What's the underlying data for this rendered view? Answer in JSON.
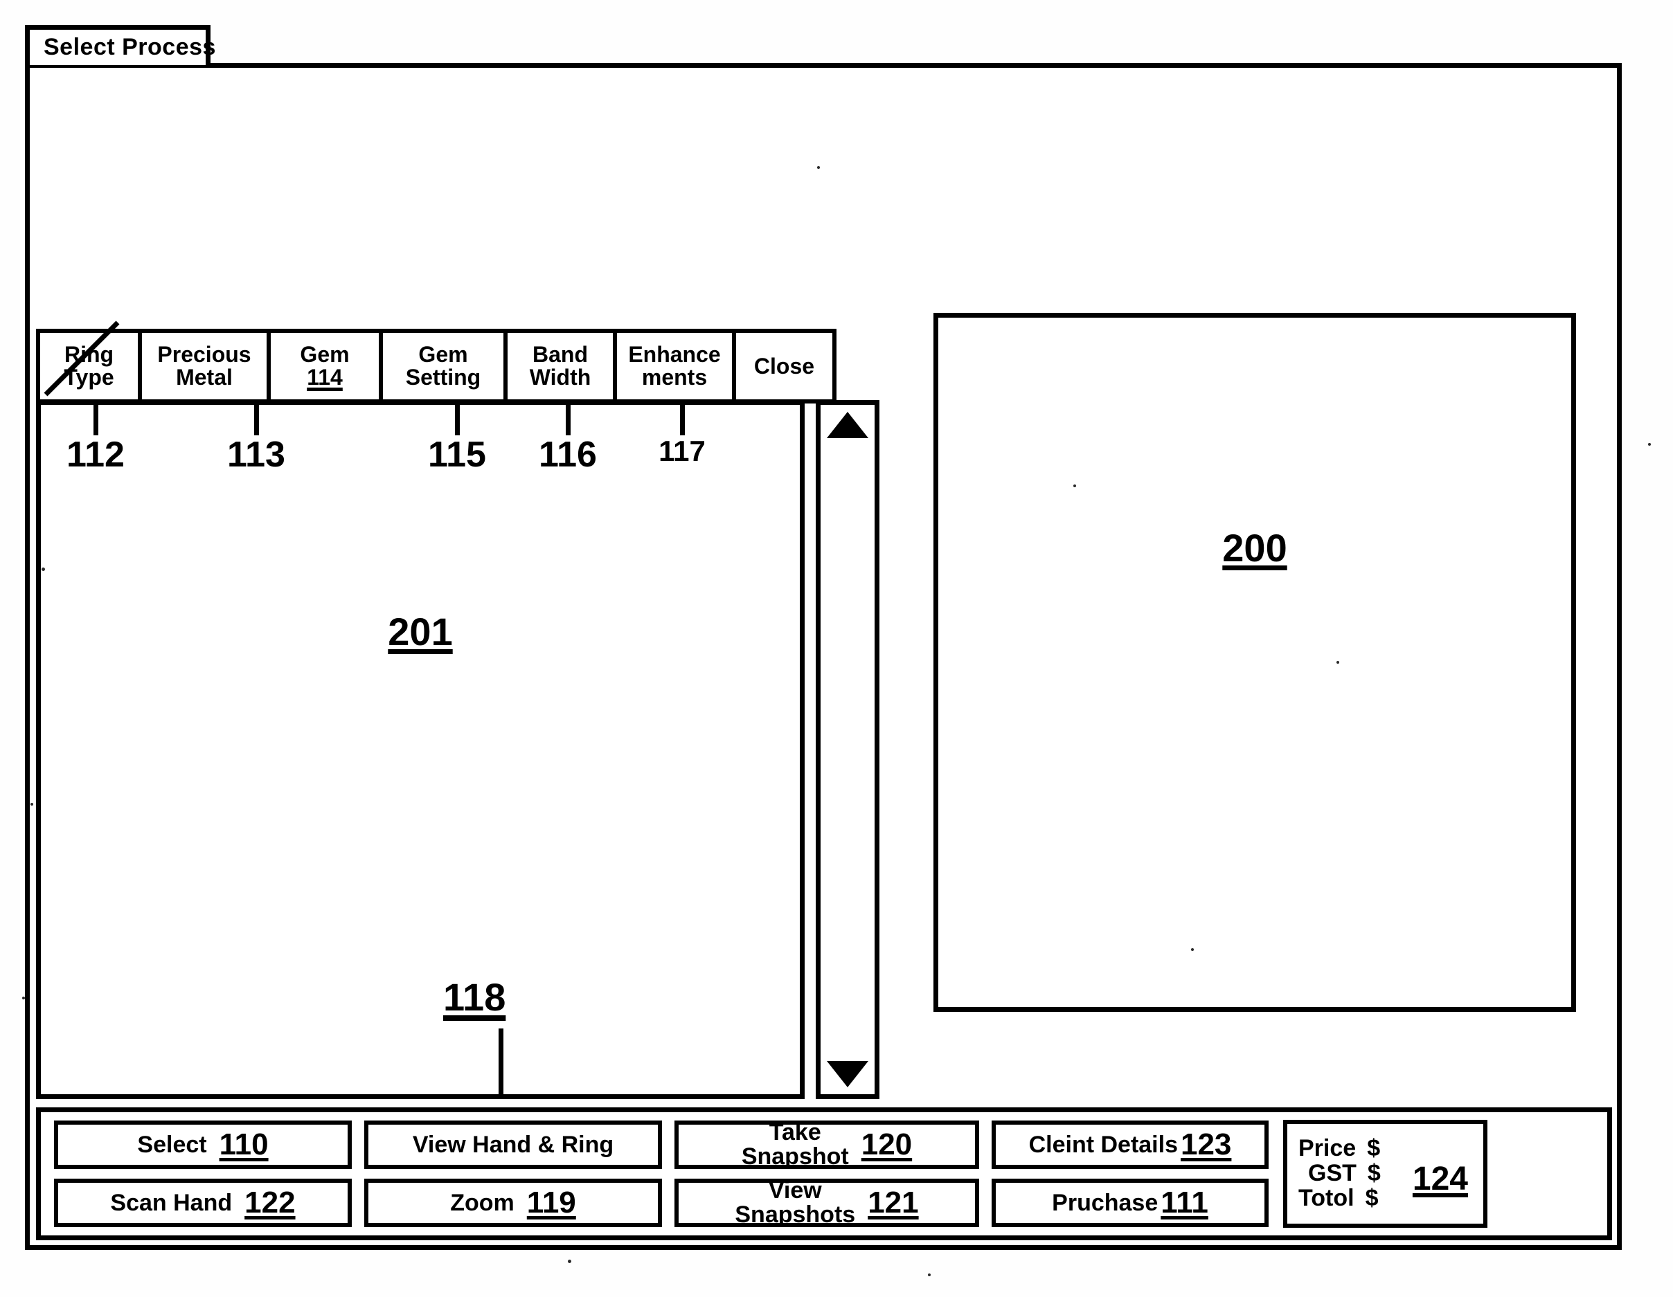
{
  "window": {
    "title": "Select Process"
  },
  "tabs": [
    {
      "id": "ring-type",
      "line1": "Ring",
      "line2": "Type",
      "ref": "112",
      "struck": true
    },
    {
      "id": "precious-metal",
      "line1": "Precious",
      "line2": "Metal",
      "ref": "113",
      "struck": false
    },
    {
      "id": "gem",
      "line1": "Gem",
      "line2": "114",
      "ref": "",
      "inline_ref": "114"
    },
    {
      "id": "gem-setting",
      "line1": "Gem",
      "line2": "Setting",
      "ref": "115",
      "struck": false
    },
    {
      "id": "band-width",
      "line1": "Band",
      "line2": "Width",
      "ref": "116",
      "struck": false
    },
    {
      "id": "enhancements",
      "line1": "Enhance",
      "line2": "ments",
      "ref": "117",
      "struck": false
    },
    {
      "id": "close",
      "line1": "Close",
      "line2": "",
      "ref": "",
      "struck": false
    }
  ],
  "callouts": {
    "ring_type": "112",
    "precious_metal": "113",
    "gem_setting": "115",
    "band_width": "116",
    "enhancements": "117"
  },
  "list_panel": {
    "ref": "201",
    "bottom_ref": "118"
  },
  "scrollbar": {
    "up_arrow": "scroll-up-icon",
    "down_arrow": "scroll-down-icon"
  },
  "preview_pane": {
    "ref": "200"
  },
  "toolbar": {
    "select": {
      "label": "Select",
      "ref": "110"
    },
    "scan_hand": {
      "label": "Scan Hand",
      "ref": "122"
    },
    "view_hand_ring": {
      "label": "View Hand & Ring",
      "ref": ""
    },
    "zoom": {
      "label": "Zoom",
      "ref": "119"
    },
    "take_snapshot": {
      "line1": "Take",
      "line2": "Snapshot",
      "ref": "120"
    },
    "view_snapshots": {
      "line1": "View",
      "line2": "Snapshots",
      "ref": "121"
    },
    "client_details": {
      "label": "Cleint Details",
      "ref": "123"
    },
    "purchase": {
      "label": "Pruchase",
      "ref": "111"
    }
  },
  "price_panel": {
    "price_label": "Price",
    "price_currency": "$",
    "gst_label": "GST",
    "gst_currency": "$",
    "total_label": "Totol",
    "total_currency": "$",
    "ref": "124"
  },
  "colors": {
    "ink": "#000000",
    "paper": "#ffffff"
  }
}
